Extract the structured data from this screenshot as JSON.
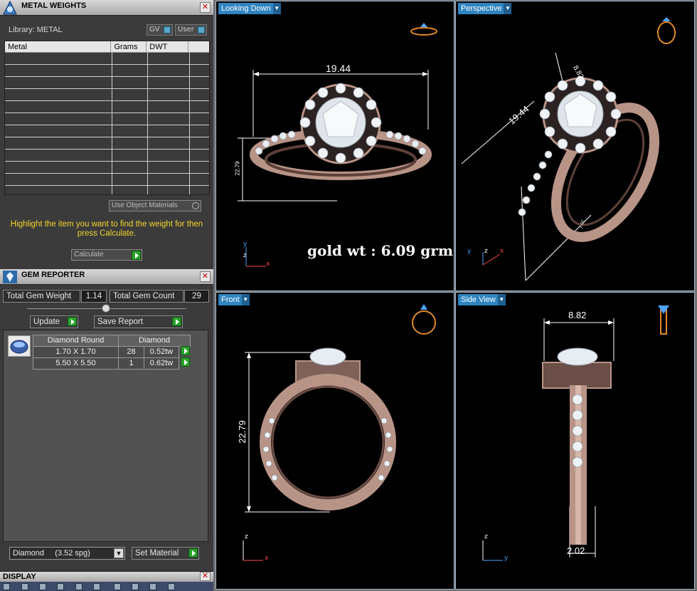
{
  "metal_weights": {
    "title": "METAL WEIGHTS",
    "library_label": "Library: METAL",
    "toggle_gv": "GV",
    "toggle_user": "User",
    "columns": [
      "Metal",
      "Grams",
      "DWT",
      ""
    ],
    "use_object_materials": "Use Object Materials",
    "hint": "Highlight the item you want to find the weight for then press Calculate.",
    "calculate_label": "Calculate"
  },
  "gem_reporter": {
    "title": "GEM REPORTER",
    "total_weight_label": "Total Gem Weight",
    "total_weight_value": "1.14",
    "total_count_label": "Total Gem Count",
    "total_count_value": "29",
    "update_label": "Update",
    "save_report_label": "Save Report",
    "table_header": [
      "Diamond Round",
      "Diamond"
    ],
    "rows": [
      {
        "size": "1.70 X 1.70",
        "count": "28",
        "weight": "0.52tw"
      },
      {
        "size": "5.50 X 5.50",
        "count": "1",
        "weight": "0.62tw"
      }
    ],
    "material_select": "Diamond     (3.52 spg)",
    "set_material_label": "Set Material"
  },
  "display": {
    "title": "DISPLAY"
  },
  "viewports": {
    "top_left": {
      "label": "Looking Down",
      "dim_width": "19.44",
      "dim_height": "22.79",
      "note": "gold wt : 6.09 grm"
    },
    "top_right": {
      "label": "Perspective",
      "dim_diag": "19.44",
      "dim_top": "8.82",
      "dim_small": "2.02"
    },
    "bottom_left": {
      "label": "Front",
      "dim_height": "22.79"
    },
    "bottom_right": {
      "label": "Side View",
      "dim_top": "8.82",
      "dim_bottom": "2.02"
    }
  },
  "colors": {
    "ring": "#c9a79a",
    "label_blue": "#2f84c0",
    "hint_yellow": "#f2d42c"
  },
  "icons": [
    "logo-icon",
    "close-icon",
    "ring-preview-icon",
    "axis-icon",
    "gem-thumbnail-icon",
    "arrow-right-icon",
    "chevron-down-icon"
  ]
}
